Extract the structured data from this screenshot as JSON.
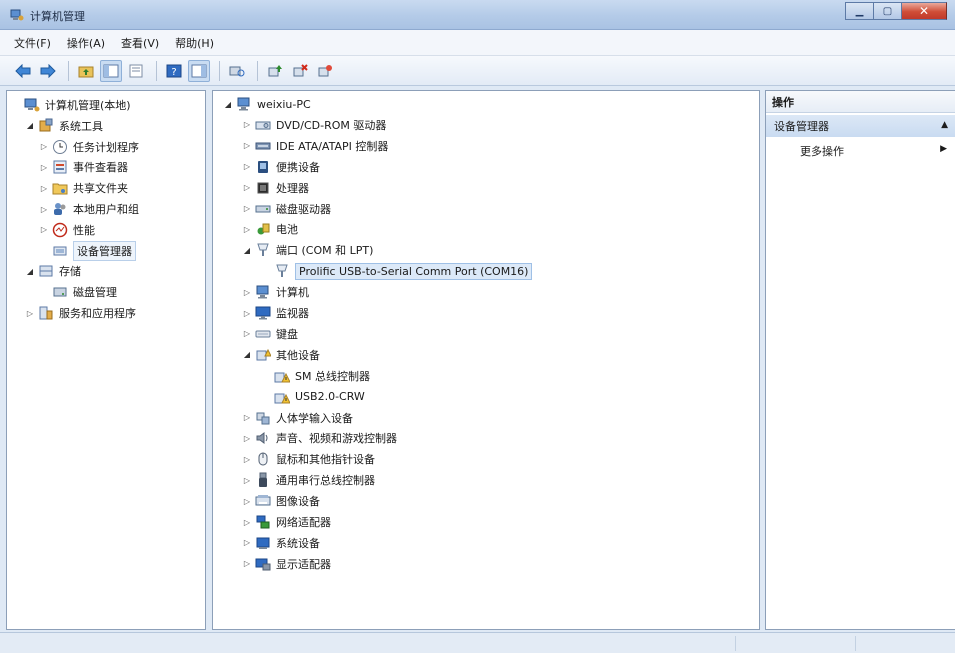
{
  "window": {
    "title": "计算机管理"
  },
  "menu": [
    "文件(F)",
    "操作(A)",
    "查看(V)",
    "帮助(H)"
  ],
  "toolbar": {
    "icons": [
      "back-icon",
      "forward-icon",
      "up-folder-icon",
      "show-hide-tree-icon",
      "properties-icon",
      "help-icon",
      "console-view-icon",
      "scan-hardware-icon",
      "update-driver-icon",
      "uninstall-icon",
      "disable-icon"
    ]
  },
  "left_tree": [
    {
      "label": "计算机管理(本地)",
      "icon": "computer-mgmt-icon",
      "level": 0,
      "arrow": ""
    },
    {
      "label": "系统工具",
      "icon": "system-tools-icon",
      "level": 1,
      "arrow": "open"
    },
    {
      "label": "任务计划程序",
      "icon": "clock-icon",
      "level": 2,
      "arrow": "closed"
    },
    {
      "label": "事件查看器",
      "icon": "event-viewer-icon",
      "level": 2,
      "arrow": "closed"
    },
    {
      "label": "共享文件夹",
      "icon": "shared-folder-icon",
      "level": 2,
      "arrow": "closed"
    },
    {
      "label": "本地用户和组",
      "icon": "users-icon",
      "level": 2,
      "arrow": "closed"
    },
    {
      "label": "性能",
      "icon": "performance-icon",
      "level": 2,
      "arrow": "closed"
    },
    {
      "label": "设备管理器",
      "icon": "device-manager-icon",
      "level": 2,
      "arrow": "",
      "selected": true
    },
    {
      "label": "存储",
      "icon": "storage-icon",
      "level": 1,
      "arrow": "open"
    },
    {
      "label": "磁盘管理",
      "icon": "disk-mgmt-icon",
      "level": 2,
      "arrow": ""
    },
    {
      "label": "服务和应用程序",
      "icon": "services-icon",
      "level": 1,
      "arrow": "closed"
    }
  ],
  "device_tree": [
    {
      "label": "weixiu-PC",
      "icon": "computer-icon",
      "level": 0,
      "arrow": "open"
    },
    {
      "label": "DVD/CD-ROM 驱动器",
      "icon": "dvd-icon",
      "level": 1,
      "arrow": "closed"
    },
    {
      "label": "IDE ATA/ATAPI 控制器",
      "icon": "ide-icon",
      "level": 1,
      "arrow": "closed"
    },
    {
      "label": "便携设备",
      "icon": "portable-device-icon",
      "level": 1,
      "arrow": "closed"
    },
    {
      "label": "处理器",
      "icon": "processor-icon",
      "level": 1,
      "arrow": "closed"
    },
    {
      "label": "磁盘驱动器",
      "icon": "disk-drive-icon",
      "level": 1,
      "arrow": "closed"
    },
    {
      "label": "电池",
      "icon": "battery-icon",
      "level": 1,
      "arrow": "closed"
    },
    {
      "label": "端口 (COM 和 LPT)",
      "icon": "port-icon",
      "level": 1,
      "arrow": "open"
    },
    {
      "label": "Prolific USB-to-Serial Comm Port (COM16)",
      "icon": "port-icon",
      "level": 2,
      "arrow": "",
      "selected": true
    },
    {
      "label": "计算机",
      "icon": "computer-icon",
      "level": 1,
      "arrow": "closed"
    },
    {
      "label": "监视器",
      "icon": "monitor-icon",
      "level": 1,
      "arrow": "closed"
    },
    {
      "label": "键盘",
      "icon": "keyboard-icon",
      "level": 1,
      "arrow": "closed"
    },
    {
      "label": "其他设备",
      "icon": "other-devices-icon",
      "level": 1,
      "arrow": "open"
    },
    {
      "label": "SM 总线控制器",
      "icon": "warning-device-icon",
      "level": 2,
      "arrow": ""
    },
    {
      "label": "USB2.0-CRW",
      "icon": "warning-device-icon",
      "level": 2,
      "arrow": ""
    },
    {
      "label": "人体学输入设备",
      "icon": "hid-icon",
      "level": 1,
      "arrow": "closed"
    },
    {
      "label": "声音、视频和游戏控制器",
      "icon": "sound-icon",
      "level": 1,
      "arrow": "closed"
    },
    {
      "label": "鼠标和其他指针设备",
      "icon": "mouse-icon",
      "level": 1,
      "arrow": "closed"
    },
    {
      "label": "通用串行总线控制器",
      "icon": "usb-icon",
      "level": 1,
      "arrow": "closed"
    },
    {
      "label": "图像设备",
      "icon": "imaging-icon",
      "level": 1,
      "arrow": "closed"
    },
    {
      "label": "网络适配器",
      "icon": "network-icon",
      "level": 1,
      "arrow": "closed"
    },
    {
      "label": "系统设备",
      "icon": "system-device-icon",
      "level": 1,
      "arrow": "closed"
    },
    {
      "label": "显示适配器",
      "icon": "display-adapter-icon",
      "level": 1,
      "arrow": "closed"
    }
  ],
  "actions": {
    "header": "操作",
    "section": "设备管理器",
    "more": "更多操作"
  }
}
